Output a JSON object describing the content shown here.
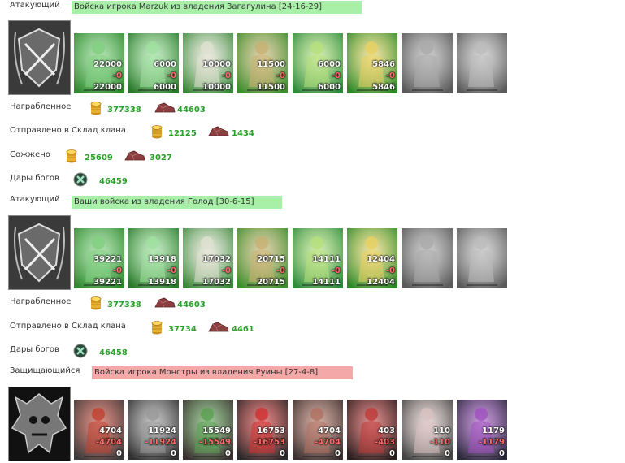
{
  "blocks": [
    {
      "role": "Атакующий",
      "banner": "Войска игрока Marzuk из владения Загагулина [24-16-29]",
      "banner_color": "#a8f0a8",
      "crest": "shield-crossed-swords-crest",
      "units": [
        {
          "a": "22000",
          "b": "-0",
          "c": "22000",
          "icon": "green-archer-icon"
        },
        {
          "a": "6000",
          "b": "-0",
          "c": "6000",
          "icon": "green-knight-icon"
        },
        {
          "a": "10000",
          "b": "-0",
          "c": "10000",
          "icon": "spearman-icon"
        },
        {
          "a": "11500",
          "b": "-0",
          "c": "11500",
          "icon": "griffin-icon"
        },
        {
          "a": "6000",
          "b": "-0",
          "c": "6000",
          "icon": "elf-archer-icon"
        },
        {
          "a": "5846",
          "b": "-0",
          "c": "5846",
          "icon": "druid-icon"
        },
        {
          "a": "",
          "b": "",
          "c": "",
          "icon": "grey-monk-icon"
        },
        {
          "a": "",
          "b": "",
          "c": "",
          "icon": "grey-mage-icon"
        }
      ],
      "resources": [
        {
          "label": "Награбленное",
          "items": [
            {
              "icon": "gold-coins-icon",
              "value": "377338"
            },
            {
              "icon": "ore-icon",
              "value": "44603"
            }
          ]
        },
        {
          "label": "Отправлено в Склад клана",
          "items": [
            {
              "icon": "gold-coins-icon",
              "value": "12125"
            },
            {
              "icon": "ore-icon",
              "value": "1434"
            }
          ]
        },
        {
          "label": "Сожжено",
          "items": [
            {
              "icon": "gold-coins-icon",
              "value": "25609"
            },
            {
              "icon": "ore-icon",
              "value": "3027"
            }
          ]
        },
        {
          "label": "Дары богов",
          "items": [
            {
              "icon": "god-gift-icon",
              "value": "46459"
            }
          ]
        }
      ]
    },
    {
      "role": "Атакующий",
      "banner": "Ваши войска из владения Голод [30-6-15]",
      "banner_color": "#a8f0a8",
      "crest": "shield-crossed-swords-crest",
      "units": [
        {
          "a": "39221",
          "b": "-0",
          "c": "39221",
          "icon": "green-archer-icon"
        },
        {
          "a": "13918",
          "b": "-0",
          "c": "13918",
          "icon": "green-knight-icon"
        },
        {
          "a": "17032",
          "b": "-0",
          "c": "17032",
          "icon": "spearman-icon"
        },
        {
          "a": "20715",
          "b": "-0",
          "c": "20715",
          "icon": "griffin-icon"
        },
        {
          "a": "14111",
          "b": "-0",
          "c": "14111",
          "icon": "elf-archer-icon"
        },
        {
          "a": "12404",
          "b": "-0",
          "c": "12404",
          "icon": "druid-icon"
        },
        {
          "a": "",
          "b": "",
          "c": "",
          "icon": "grey-monk-icon"
        },
        {
          "a": "",
          "b": "",
          "c": "",
          "icon": "grey-mage-icon"
        }
      ],
      "resources": [
        {
          "label": "Награбленное",
          "items": [
            {
              "icon": "gold-coins-icon",
              "value": "377338"
            },
            {
              "icon": "ore-icon",
              "value": "44603"
            }
          ]
        },
        {
          "label": "Отправлено в Склад клана",
          "items": [
            {
              "icon": "gold-coins-icon",
              "value": "37734"
            },
            {
              "icon": "ore-icon",
              "value": "4461"
            }
          ]
        },
        {
          "label": "Дары богов",
          "items": [
            {
              "icon": "god-gift-icon",
              "value": "46458"
            }
          ]
        }
      ]
    },
    {
      "role": "Защищающийся",
      "banner": "Войска игрока Монстры из владения Руины [27-4-8]",
      "banner_color": "#f4a8a8",
      "crest": "demon-skull-crest",
      "units": [
        {
          "a": "4704",
          "b": "-4704",
          "c": "0",
          "icon": "lizard-warrior-icon"
        },
        {
          "a": "11924",
          "b": "-11924",
          "c": "0",
          "icon": "armored-beast-icon"
        },
        {
          "a": "15549",
          "b": "-15549",
          "c": "0",
          "icon": "orc-warrior-icon"
        },
        {
          "a": "16753",
          "b": "-16753",
          "c": "0",
          "icon": "red-demon-icon"
        },
        {
          "a": "4704",
          "b": "-4704",
          "c": "0",
          "icon": "spider-icon"
        },
        {
          "a": "403",
          "b": "-403",
          "c": "0",
          "icon": "red-dragon-icon"
        },
        {
          "a": "110",
          "b": "-110",
          "c": "0",
          "icon": "golem-icon"
        },
        {
          "a": "1179",
          "b": "-1179",
          "c": "0",
          "icon": "purple-demon-icon"
        }
      ]
    }
  ]
}
